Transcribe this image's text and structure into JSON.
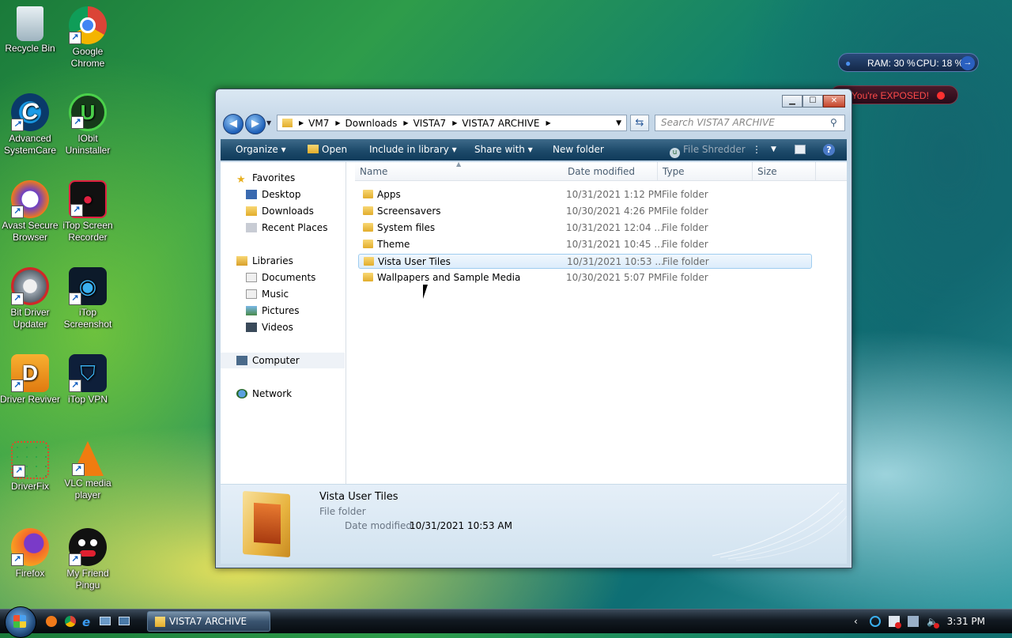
{
  "desktop": {
    "icons": [
      {
        "label": "Recycle Bin"
      },
      {
        "label": "Google Chrome"
      },
      {
        "label": "Advanced SystemCare"
      },
      {
        "label": "IObit Uninstaller"
      },
      {
        "label": "Avast Secure Browser"
      },
      {
        "label": "iTop Screen Recorder"
      },
      {
        "label": "Bit Driver Updater"
      },
      {
        "label": "iTop Screenshot"
      },
      {
        "label": "Driver Reviver"
      },
      {
        "label": "iTop VPN"
      },
      {
        "label": "DriverFix"
      },
      {
        "label": "VLC media player"
      },
      {
        "label": "Firefox"
      },
      {
        "label": "My Friend Pingu"
      }
    ]
  },
  "gadgets": {
    "system_monitor": {
      "ram": "RAM: 30 %",
      "cpu": "CPU: 18 %"
    },
    "exposed": {
      "text": "You're EXPOSED!"
    }
  },
  "window": {
    "breadcrumb": [
      "VM7",
      "Downloads",
      "VISTA7",
      "VISTA7 ARCHIVE"
    ],
    "search_placeholder": "Search VISTA7 ARCHIVE",
    "toolbar": {
      "organize": "Organize",
      "open": "Open",
      "include_in_library": "Include in library",
      "share_with": "Share with",
      "new_folder": "New folder",
      "file_shredder": "File Shredder"
    },
    "nav": {
      "favorites": "Favorites",
      "desktop": "Desktop",
      "downloads": "Downloads",
      "recent_places": "Recent Places",
      "libraries": "Libraries",
      "documents": "Documents",
      "music": "Music",
      "pictures": "Pictures",
      "videos": "Videos",
      "computer": "Computer",
      "network": "Network"
    },
    "columns": {
      "name": "Name",
      "date_modified": "Date modified",
      "type": "Type",
      "size": "Size"
    },
    "files": [
      {
        "name": "Apps",
        "date": "10/31/2021 1:12 PM",
        "type": "File folder"
      },
      {
        "name": "Screensavers",
        "date": "10/30/2021 4:26 PM",
        "type": "File folder"
      },
      {
        "name": "System files",
        "date": "10/31/2021 12:04 ...",
        "type": "File folder"
      },
      {
        "name": "Theme",
        "date": "10/31/2021 10:45 ...",
        "type": "File folder"
      },
      {
        "name": "Vista User Tiles",
        "date": "10/31/2021 10:53 ...",
        "type": "File folder"
      },
      {
        "name": "Wallpapers and Sample Media",
        "date": "10/30/2021 5:07 PM",
        "type": "File folder"
      }
    ],
    "details": {
      "name": "Vista User Tiles",
      "type": "File folder",
      "date_label": "Date modified:",
      "date_value": "10/31/2021 10:53 AM"
    }
  },
  "taskbar": {
    "task_label": "VISTA7 ARCHIVE",
    "clock": "3:31 PM"
  },
  "colors": {
    "toolbar": "#1d4a6a",
    "selection": "#dcecfb",
    "accent_blue": "#1d5fb8"
  }
}
